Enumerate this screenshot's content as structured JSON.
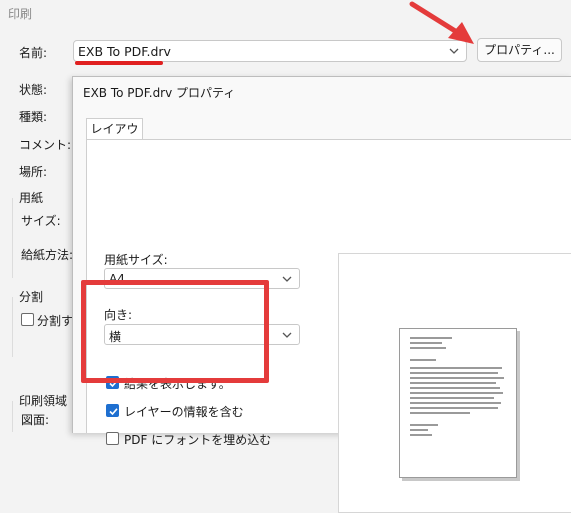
{
  "background": {
    "title": "印刷",
    "name_label": "名前:",
    "printer_value": "EXB To PDF.drv",
    "properties_button": "プロパティ...",
    "status_label": "状態:",
    "type_label": "種類:",
    "comment_label": "コメント:",
    "location_label": "場所:",
    "paper_group": "用紙",
    "size_label": "サイズ:",
    "feed_label": "給紙方法:",
    "split_group": "分割",
    "split_check_label": "分割す",
    "print_area_group": "印刷領域",
    "drawing_label": "図面:"
  },
  "dialog": {
    "title": "EXB To PDF.drv プロパティ",
    "tab_label": "レイアウト",
    "paper_size_label": "用紙サイズ:",
    "paper_size_value": "A4",
    "orientation_label": "向き:",
    "orientation_value": "横",
    "options": [
      {
        "label": "結果を表示します。",
        "checked": true
      },
      {
        "label": "レイヤーの情報を含む",
        "checked": true
      },
      {
        "label": "PDF にフォントを埋め込む",
        "checked": false
      }
    ]
  },
  "colors": {
    "accent": "#1e6fd0",
    "annotation_red": "#e43b3b"
  }
}
